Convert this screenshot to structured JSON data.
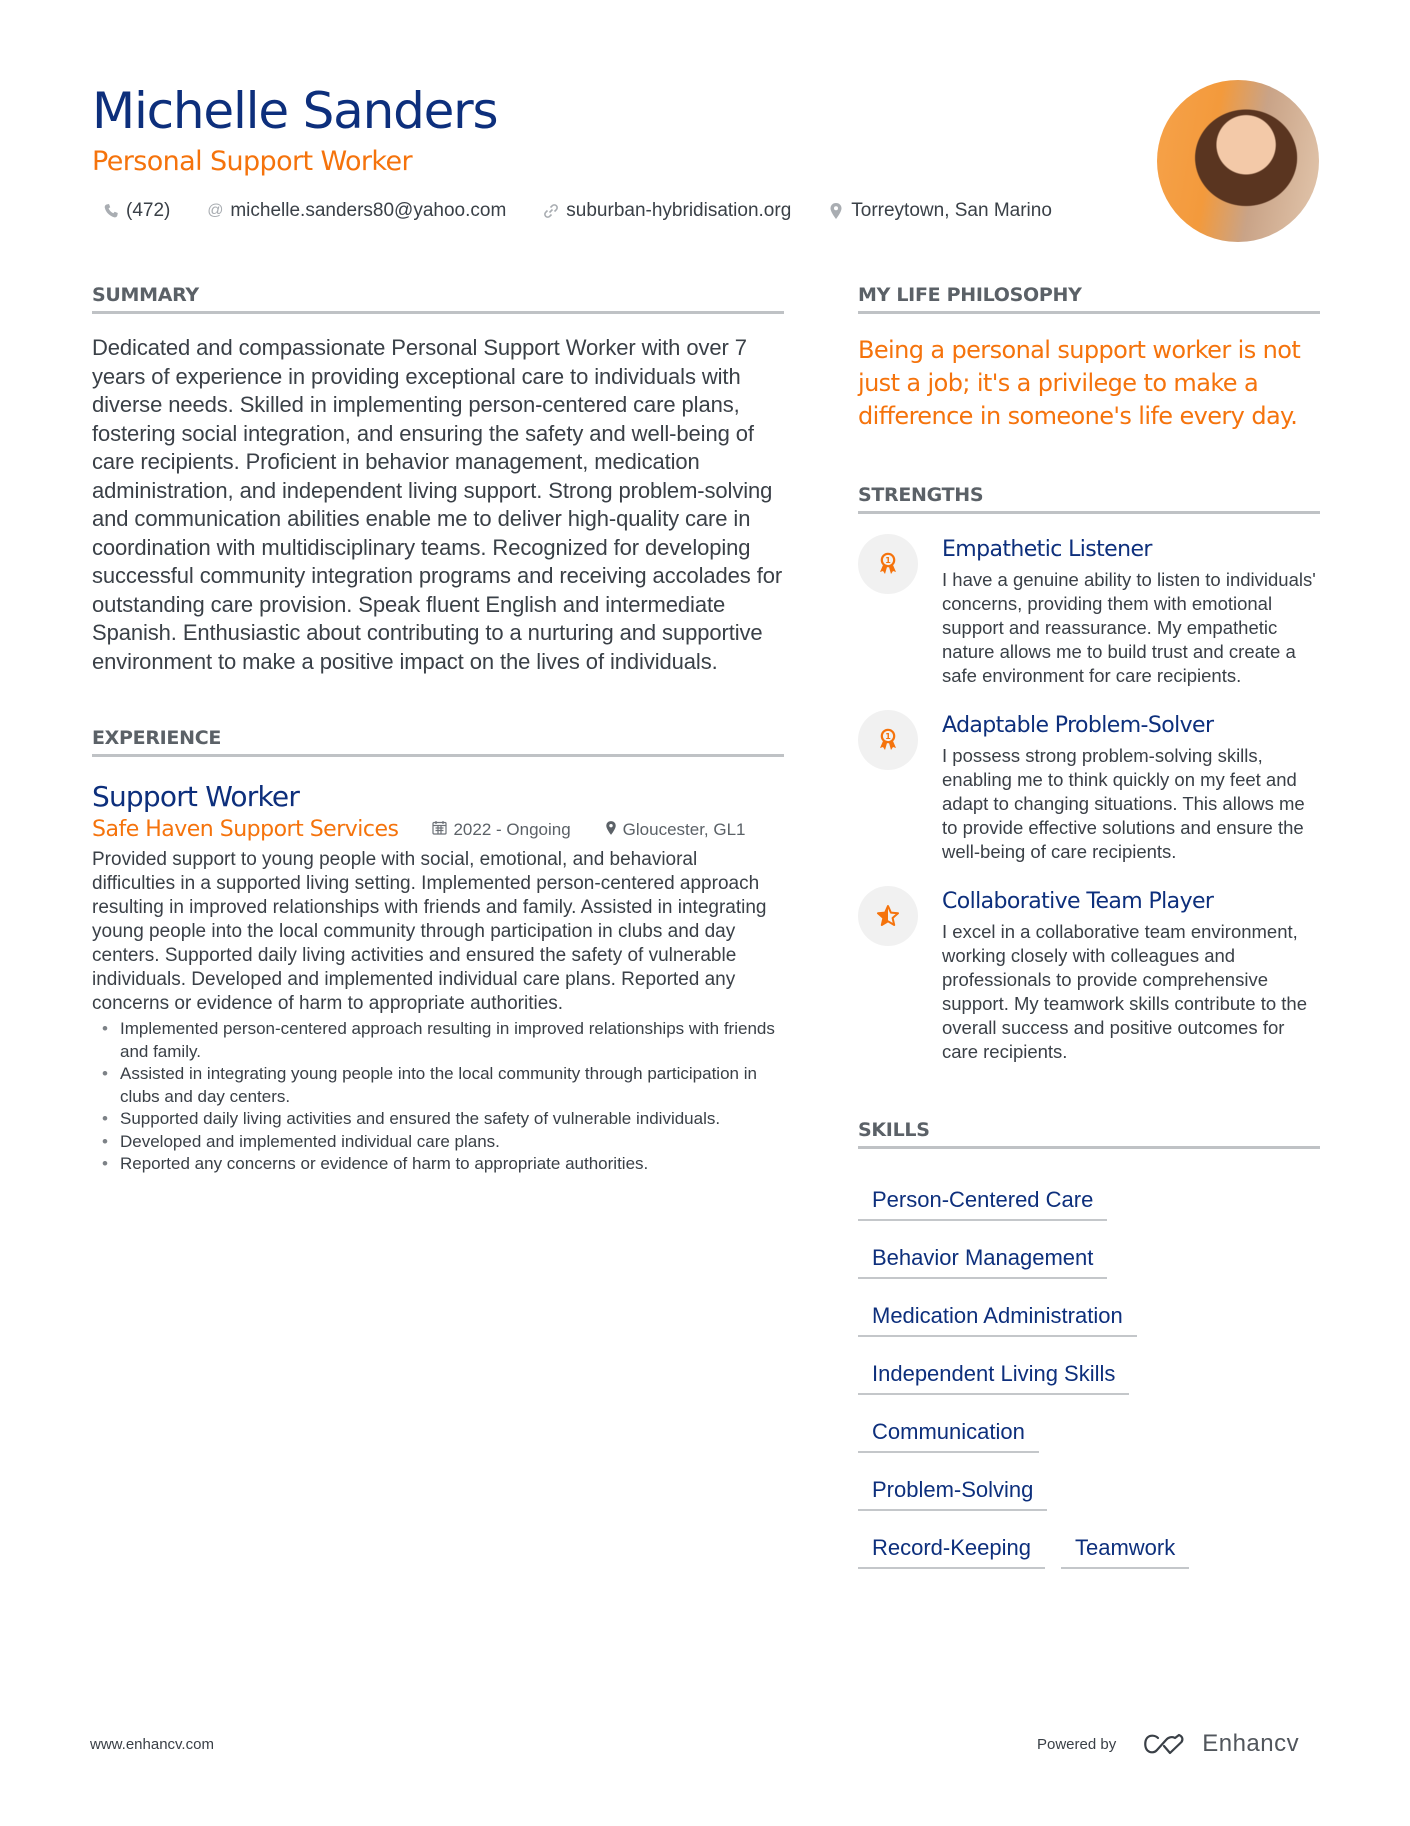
{
  "header": {
    "name": "Michelle Sanders",
    "title": "Personal Support Worker",
    "contacts": [
      {
        "icon": "phone-icon",
        "text": "(472)"
      },
      {
        "icon": "at-icon",
        "text": "michelle.sanders80@yahoo.com"
      },
      {
        "icon": "link-icon",
        "text": "suburban-hybridisation.org"
      },
      {
        "icon": "location-icon",
        "text": "Torreytown, San Marino"
      }
    ]
  },
  "summary": {
    "heading": "SUMMARY",
    "text": "Dedicated and compassionate Personal Support Worker with over 7 years of experience in providing exceptional care to individuals with diverse needs. Skilled in implementing person-centered care plans, fostering social integration, and ensuring the safety and well-being of care recipients. Proficient in behavior management, medication administration, and independent living support. Strong problem-solving and communication abilities enable me to deliver high-quality care in coordination with multidisciplinary teams. Recognized for developing successful community integration programs and receiving accolades for outstanding care provision. Speak fluent English and intermediate Spanish. Enthusiastic about contributing to a nurturing and supportive environment to make a positive impact on the lives of individuals."
  },
  "experience": {
    "heading": "EXPERIENCE",
    "jobs": [
      {
        "title": "Support Worker",
        "company": "Safe Haven Support Services",
        "dates": "2022 - Ongoing",
        "location": "Gloucester, GL1",
        "description": "Provided support to young people with social, emotional, and behavioral difficulties in a supported living setting. Implemented person-centered approach resulting in improved relationships with friends and family. Assisted in integrating young people into the local community through participation in clubs and day centers. Supported daily living activities and ensured the safety of vulnerable individuals. Developed and implemented individual care plans. Reported any concerns or evidence of harm to appropriate authorities.",
        "bullets": [
          "Implemented person-centered approach resulting in improved relationships with friends and family.",
          "Assisted in integrating young people into the local community through participation in clubs and day centers.",
          "Supported daily living activities and ensured the safety of vulnerable individuals.",
          "Developed and implemented individual care plans.",
          "Reported any concerns or evidence of harm to appropriate authorities."
        ]
      }
    ]
  },
  "philosophy": {
    "heading": "MY LIFE PHILOSOPHY",
    "quote": "Being a personal support worker is not just a job; it's a privilege to make a difference in someone's life every day."
  },
  "strengths": {
    "heading": "STRENGTHS",
    "items": [
      {
        "icon": "award-ribbon-icon",
        "title": "Empathetic Listener",
        "description": "I have a genuine ability to listen to individuals' concerns, providing them with emotional support and reassurance. My empathetic nature allows me to build trust and create a safe environment for care recipients."
      },
      {
        "icon": "award-ribbon-icon",
        "title": "Adaptable Problem-Solver",
        "description": "I possess strong problem-solving skills, enabling me to think quickly on my feet and adapt to changing situations. This allows me to provide effective solutions and ensure the well-being of care recipients."
      },
      {
        "icon": "half-star-icon",
        "title": "Collaborative Team Player",
        "description": "I excel in a collaborative team environment, working closely with colleagues and professionals to provide comprehensive support. My teamwork skills contribute to the overall success and positive outcomes for care recipients."
      }
    ]
  },
  "skills": {
    "heading": "SKILLS",
    "items": [
      "Person-Centered Care",
      "Behavior Management",
      "Medication Administration",
      "Independent Living Skills",
      "Communication",
      "Problem-Solving",
      "Record-Keeping",
      "Teamwork"
    ]
  },
  "footer": {
    "website": "www.enhancv.com",
    "powered_by": "Powered by",
    "brand": "Enhancv"
  },
  "colors": {
    "primary": "#0d2f7c",
    "accent": "#f5730c",
    "text": "#3a4047",
    "rule": "#bfc2c5"
  }
}
